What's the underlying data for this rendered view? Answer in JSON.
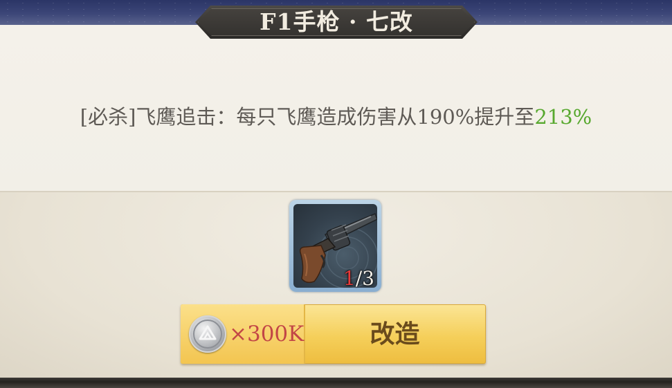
{
  "header": {
    "title": "F1手枪 · 七改"
  },
  "description": {
    "prefix": "[必杀]飞鹰追击：每只飞鹰造成伤害从190%提升至",
    "highlight": "213%",
    "highlight_color": "#57a82e"
  },
  "material": {
    "icon": "revolver-icon",
    "owned": "1",
    "required": "/3",
    "owned_color": "#e83a3a"
  },
  "forge": {
    "cost_icon": "silver-coin-icon",
    "cost_text": "×300K",
    "cost_color": "#c24646",
    "label": "改造"
  }
}
